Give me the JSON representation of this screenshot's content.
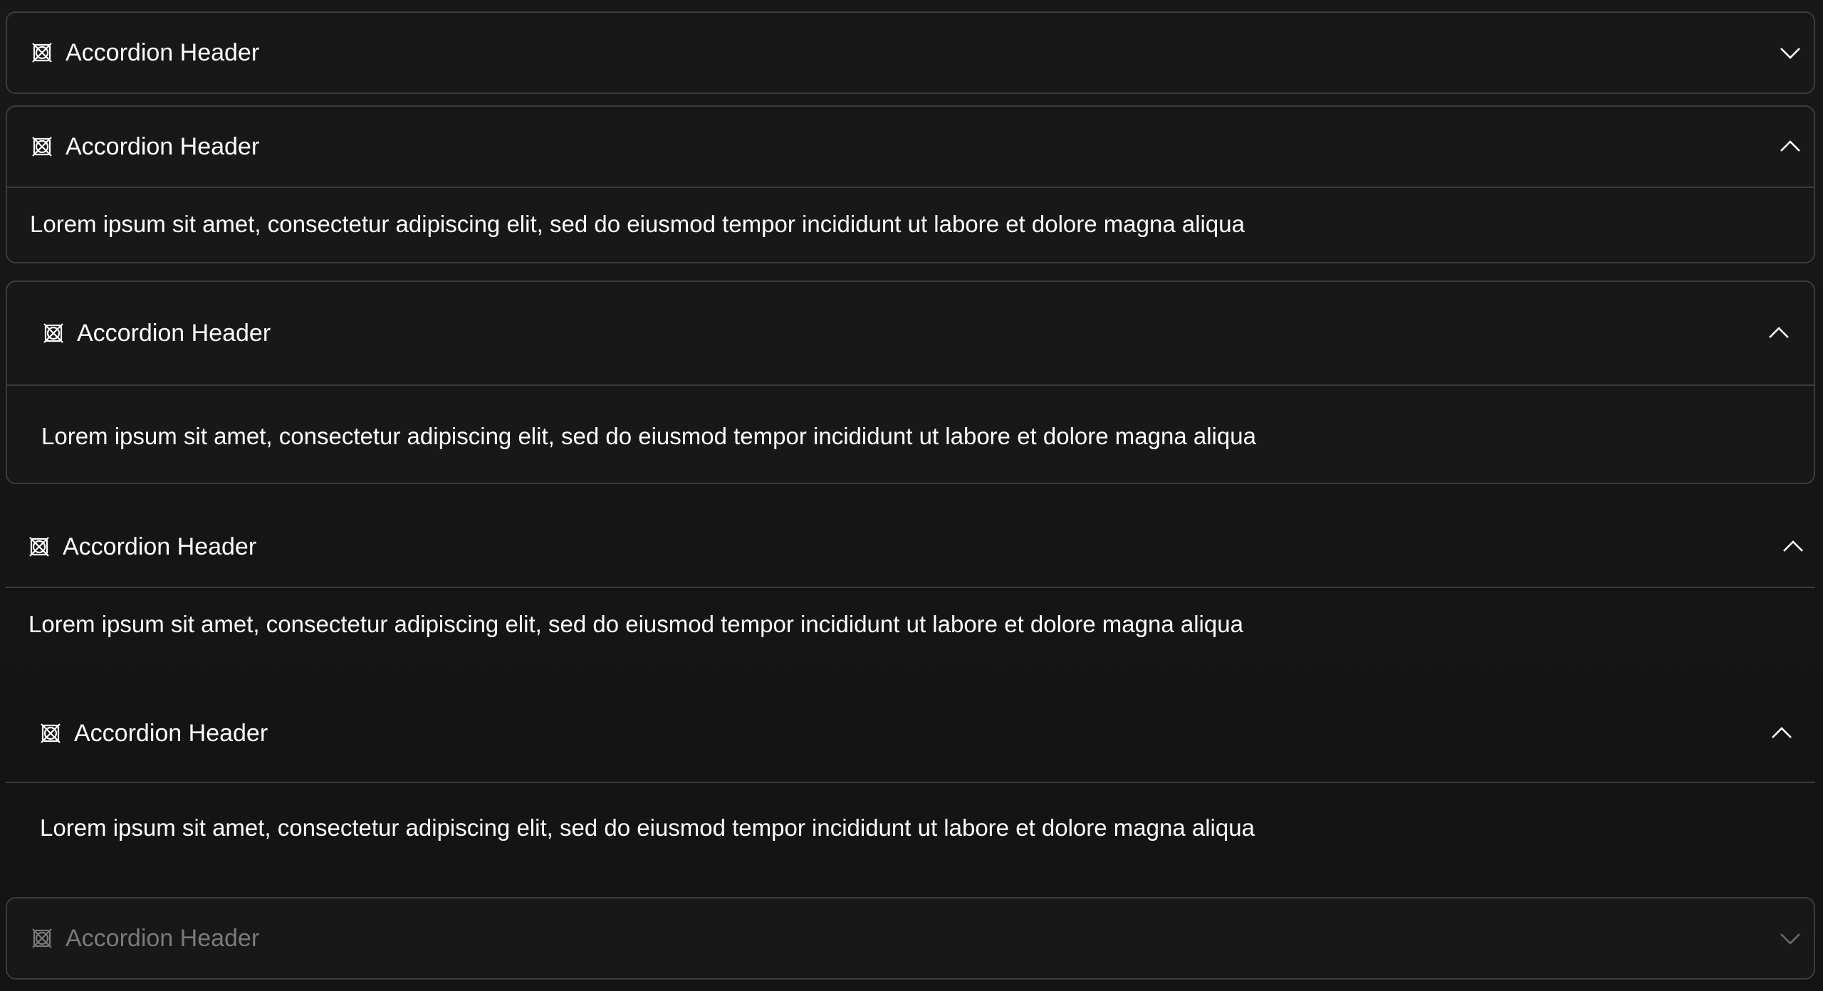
{
  "accordions": [
    {
      "header": "Accordion Header",
      "expanded": false,
      "disabled": false
    },
    {
      "header": "Accordion Header",
      "expanded": true,
      "disabled": false,
      "body": "Lorem ipsum sit amet, consectetur adipiscing elit, sed do eiusmod tempor incididunt ut labore et dolore magna aliqua"
    },
    {
      "header": "Accordion Header",
      "expanded": true,
      "disabled": false,
      "body": "Lorem ipsum sit amet, consectetur adipiscing elit, sed do eiusmod tempor incididunt ut labore et dolore magna aliqua"
    },
    {
      "header": "Accordion Header",
      "expanded": true,
      "disabled": false,
      "body": "Lorem ipsum sit amet, consectetur adipiscing elit, sed do eiusmod tempor incididunt ut labore et dolore magna aliqua"
    },
    {
      "header": "Accordion Header",
      "expanded": true,
      "disabled": false,
      "body": "Lorem ipsum sit amet, consectetur adipiscing elit, sed do eiusmod tempor incididunt ut labore et dolore magna aliqua"
    },
    {
      "header": "Accordion Header",
      "expanded": false,
      "disabled": true
    }
  ],
  "icons": {
    "leading": "crossed-box-icon",
    "expand": "chevron-down-icon",
    "collapse": "chevron-up-icon"
  },
  "colors": {
    "background": "#151515",
    "border": "#3b3b3b",
    "text": "#ffffff",
    "disabled_text": "#7a7a7a"
  }
}
